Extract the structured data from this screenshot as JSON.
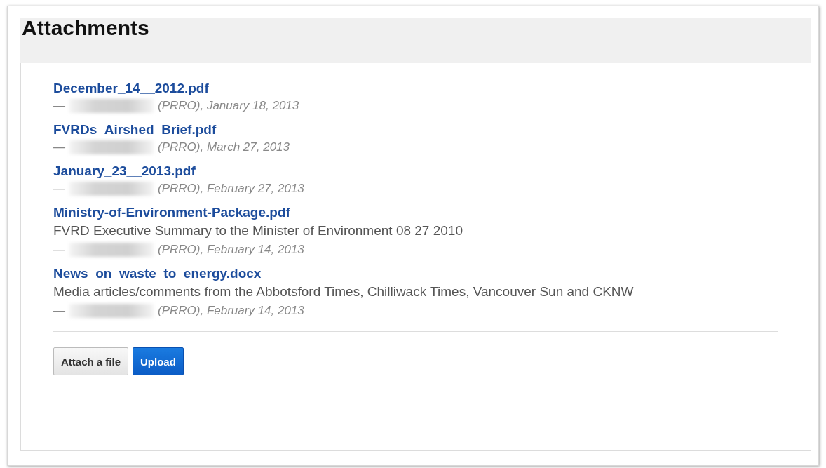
{
  "title": "Attachments",
  "attachments": [
    {
      "filename": "December_14__2012.pdf",
      "author_prefix": "—",
      "author_suffix": "(PRRO), January 18, 2013"
    },
    {
      "filename": "FVRDs_Airshed_Brief.pdf",
      "author_prefix": "—",
      "author_suffix": "(PRRO), March 27, 2013"
    },
    {
      "filename": "January_23__2013.pdf",
      "author_prefix": "—",
      "author_suffix": "(PRRO), February 27, 2013"
    },
    {
      "filename": "Ministry-of-Environment-Package.pdf",
      "description": "FVRD Executive Summary to the Minister of Environment 08 27 2010",
      "author_prefix": "—",
      "author_suffix": "(PRRO), February 14, 2013"
    },
    {
      "filename": "News_on_waste_to_energy.docx",
      "description": "Media articles/comments from the Abbotsford Times, Chilliwack Times, Vancouver Sun and CKNW",
      "author_prefix": "—",
      "author_suffix": "(PRRO), February 14, 2013"
    }
  ],
  "buttons": [
    {
      "label": "Attach a file",
      "kind": "secondary"
    },
    {
      "label": "Upload",
      "kind": "primary"
    }
  ]
}
